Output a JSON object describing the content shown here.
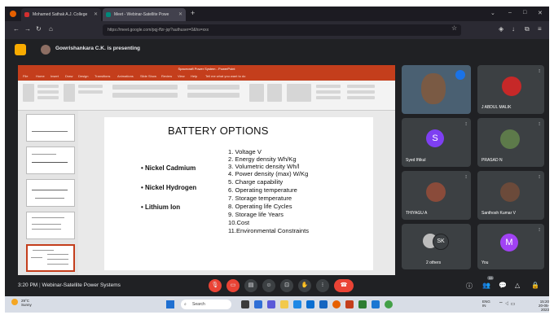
{
  "browser": {
    "tabs": [
      {
        "label": "Mohamed Sathak A.J. College",
        "active": false
      },
      {
        "label": "Meet - Webinar-Satellite Powe",
        "active": true
      }
    ],
    "url": "https://meet.google.com/pqj-ffzr-jqr?authuser=0&hs=xxx"
  },
  "meet": {
    "presenting_text": "Gowrishankara C.K. is presenting",
    "time": "3:20 PM",
    "meeting_title": "Webinar-Satellite Power Systems",
    "separator": "|",
    "participant_count": "33"
  },
  "powerpoint": {
    "window_title": "Spacecraft Power System - PowerPoint",
    "menu": [
      "File",
      "Home",
      "Insert",
      "Draw",
      "Design",
      "Transitions",
      "Animations",
      "Slide Show",
      "Review",
      "View",
      "Help",
      "Tell me what you want to do"
    ],
    "slide": {
      "title": "BATTERY OPTIONS",
      "bullets": [
        "• Nickel Cadmium",
        "• Nickel Hydrogen",
        "• Lithium Ion"
      ],
      "options": [
        "1.  Voltage                V",
        "2.   Energy density   Wh/Kg",
        "3.   Volumetric density  Wh/l",
        "4.   Power density (max)       W/Kg",
        "5.  Charge capability",
        "6.  Operating temperature",
        "7.  Storage temperature",
        "8.  Operating life Cycles",
        "9.  Storage life Years",
        "10.Cost",
        "11.Environmental Constraints"
      ]
    }
  },
  "participants": [
    {
      "name": "",
      "initial": ""
    },
    {
      "name": "J ABDUL MALIK",
      "initial": ""
    },
    {
      "name": "Syed Iftikul",
      "initial": "S"
    },
    {
      "name": "PRASAD N",
      "initial": ""
    },
    {
      "name": "THIYAGU A",
      "initial": ""
    },
    {
      "name": "Santhosh Kumar V",
      "initial": ""
    },
    {
      "name": "2 others",
      "initial": "SK"
    },
    {
      "name": "You",
      "initial": "M"
    }
  ],
  "taskbar": {
    "weather_temp": "29°C",
    "weather_desc": "Sunny",
    "search_label": "Search",
    "lang": "ENG",
    "lang_region": "IN",
    "clock_time": "15:20",
    "clock_date": "20-05-2023"
  },
  "colors": {
    "meet_bg": "#202124",
    "ppt_red": "#c43e1c",
    "end_call": "#ea4335",
    "avatar_purple": "#7e3ff2",
    "avatar_magenta": "#a142f4"
  }
}
